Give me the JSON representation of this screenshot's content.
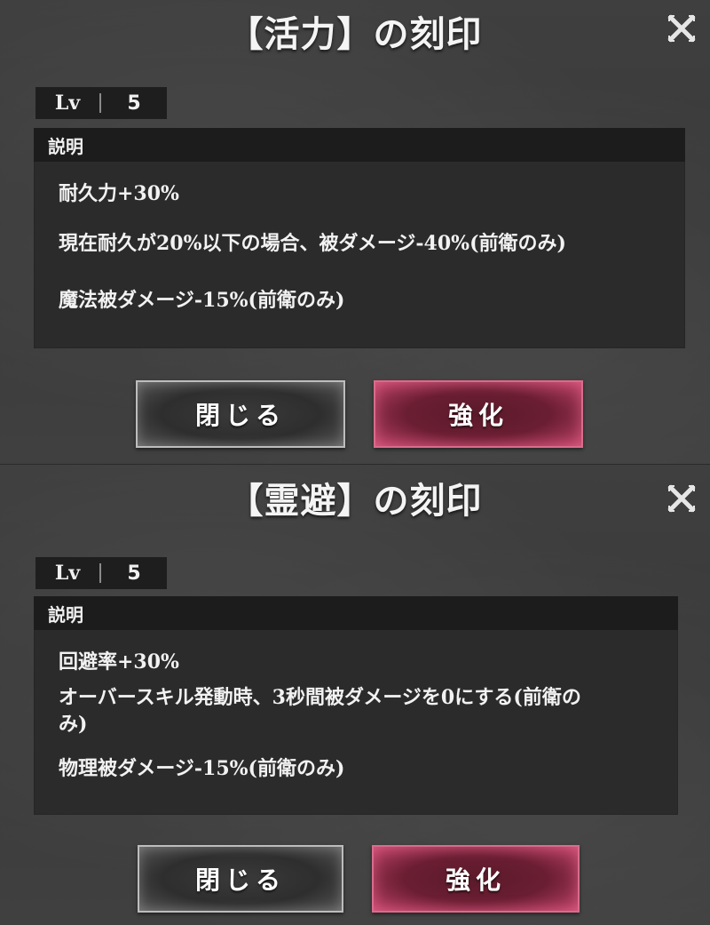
{
  "dialogs": [
    {
      "title": "【活力】の刻印",
      "level_label": "Lv",
      "level_value": "5",
      "description_header": "説明",
      "lines": [
        "耐久力+30%",
        "現在耐久が20%以下の場合、被ダメージ-40%(前衛のみ)",
        "魔法被ダメージ-15%(前衛のみ)"
      ],
      "close_button": "閉じる",
      "enhance_button": "強化",
      "close_icon": "close-icon"
    },
    {
      "title": "【霊避】の刻印",
      "level_label": "Lv",
      "level_value": "5",
      "description_header": "説明",
      "lines": [
        "回避率+30%",
        "オーバースキル発動時、3秒間被ダメージを0にする(前衛の",
        "み)",
        "物理被ダメージ-15%(前衛のみ)"
      ],
      "close_button": "閉じる",
      "enhance_button": "強化",
      "close_icon": "close-icon"
    }
  ],
  "colors": {
    "background": "#3a3a3a",
    "enhance_button": "#c0446a",
    "close_button_border": "#bdbdbd"
  }
}
